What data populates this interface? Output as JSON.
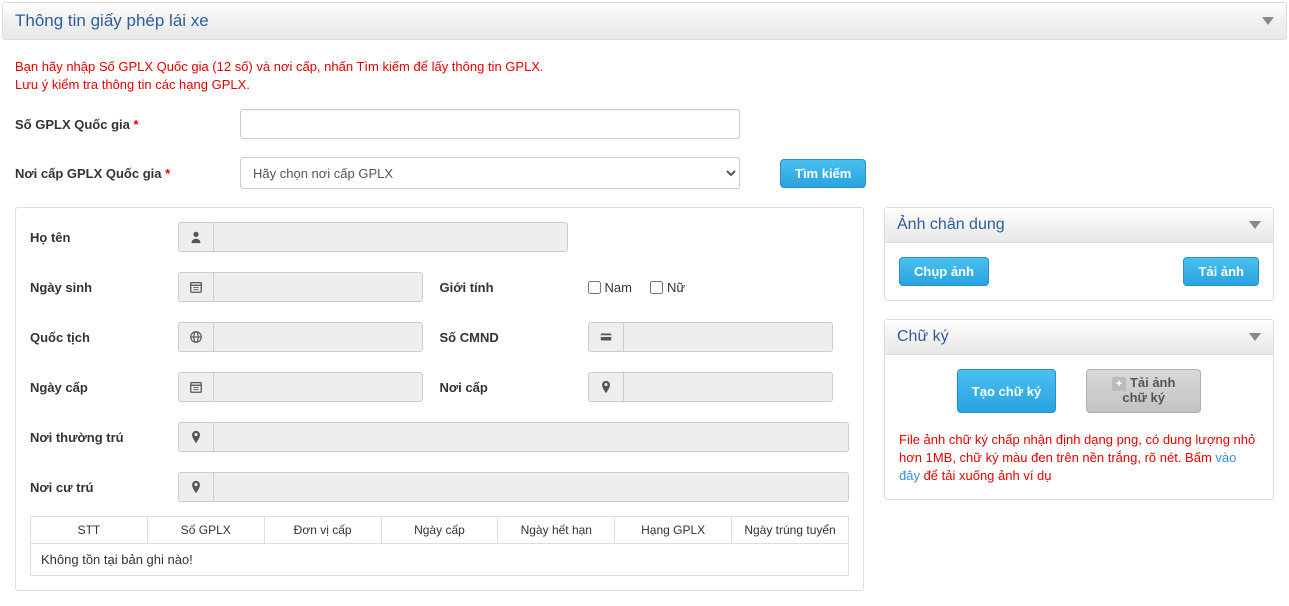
{
  "panel": {
    "title": "Thông tin giấy phép lái xe"
  },
  "hint": {
    "line1": "Bạn hãy nhập Số GPLX Quốc gia (12 số) và nơi cấp, nhấn Tìm kiếm để lấy thông tin GPLX.",
    "line2": "Lưu ý kiểm tra thông tin các hạng GPLX."
  },
  "search": {
    "labels": {
      "number": "Số GPLX Quốc gia",
      "place": "Nơi cấp GPLX Quốc gia"
    },
    "select_placeholder": "Hãy chọn nơi cấp GPLX",
    "btn_search": "Tìm kiếm"
  },
  "fields": {
    "fullname": "Họ tên",
    "dob": "Ngày sinh",
    "gender": "Giới tính",
    "gender_male": "Nam",
    "gender_female": "Nữ",
    "nationality": "Quốc tịch",
    "idno": "Số CMND",
    "issue_date": "Ngày cấp",
    "issue_place": "Nơi cấp",
    "perm_addr": "Nơi thường trú",
    "curr_addr": "Nơi cư trú"
  },
  "table": {
    "headers": [
      "STT",
      "Số GPLX",
      "Đơn vị cấp",
      "Ngày cấp",
      "Ngày hết hạn",
      "Hạng GPLX",
      "Ngày trúng tuyển"
    ],
    "no_data": "Không tồn tại bản ghi nào!"
  },
  "portrait": {
    "title": "Ảnh chân dung",
    "btn_capture": "Chụp ảnh",
    "btn_upload": "Tải ảnh"
  },
  "signature": {
    "title": "Chữ ký",
    "btn_create": "Tạo chữ ký",
    "btn_upload": "Tải ảnh chữ ký",
    "note_before": "File ảnh chữ ký chấp nhận định dạng png, có dung lượng nhỏ hơn 1MB, chữ ký màu đen trên nền trắng, rõ nét. Bấm ",
    "link": "vào đây",
    "note_after": " để tải xuống ảnh ví dụ"
  }
}
